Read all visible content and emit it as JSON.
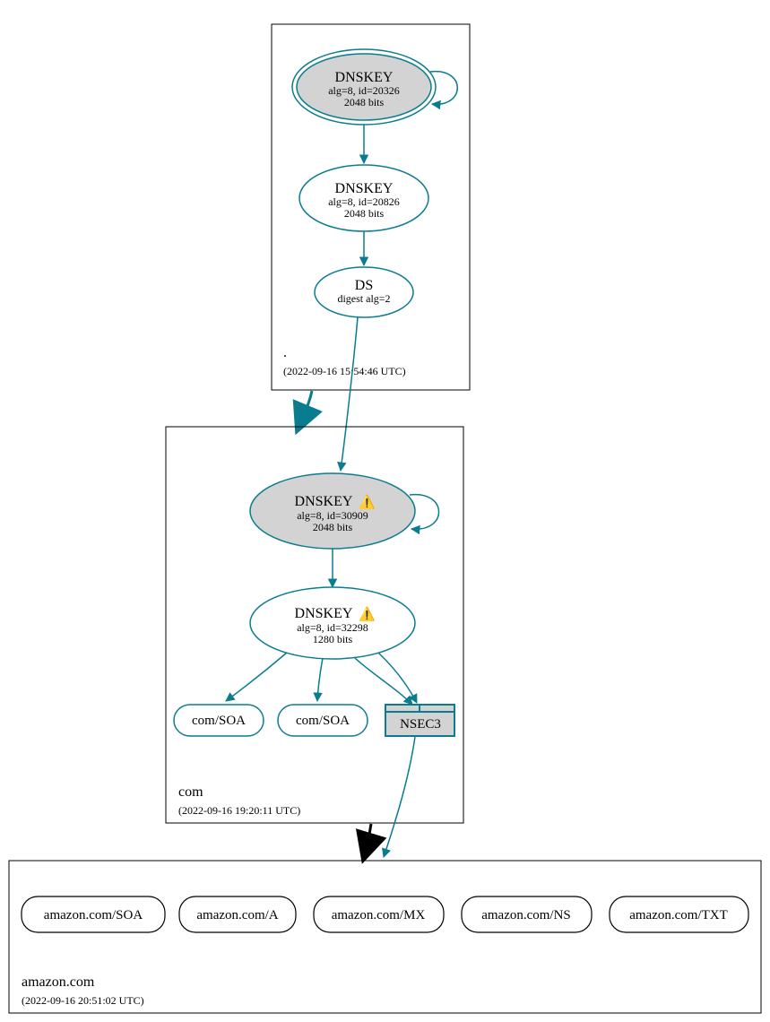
{
  "zones": {
    "root": {
      "name": ".",
      "timestamp": "(2022-09-16 15:54:46 UTC)"
    },
    "com": {
      "name": "com",
      "timestamp": "(2022-09-16 19:20:11 UTC)"
    },
    "leaf": {
      "name": "amazon.com",
      "timestamp": "(2022-09-16 20:51:02 UTC)"
    }
  },
  "nodes": {
    "root_ksk": {
      "title": "DNSKEY",
      "l1": "alg=8, id=20326",
      "l2": "2048 bits"
    },
    "root_zsk": {
      "title": "DNSKEY",
      "l1": "alg=8, id=20826",
      "l2": "2048 bits"
    },
    "root_ds": {
      "title": "DS",
      "l1": "digest alg=2"
    },
    "com_ksk": {
      "title": "DNSKEY",
      "warn": "⚠️",
      "l1": "alg=8, id=30909",
      "l2": "2048 bits"
    },
    "com_zsk": {
      "title": "DNSKEY",
      "warn": "⚠️",
      "l1": "alg=8, id=32298",
      "l2": "1280 bits"
    },
    "com_soa1": "com/SOA",
    "com_soa2": "com/SOA",
    "com_nsec3": "NSEC3",
    "leaf_soa": "amazon.com/SOA",
    "leaf_a": "amazon.com/A",
    "leaf_mx": "amazon.com/MX",
    "leaf_ns": "amazon.com/NS",
    "leaf_txt": "amazon.com/TXT"
  }
}
